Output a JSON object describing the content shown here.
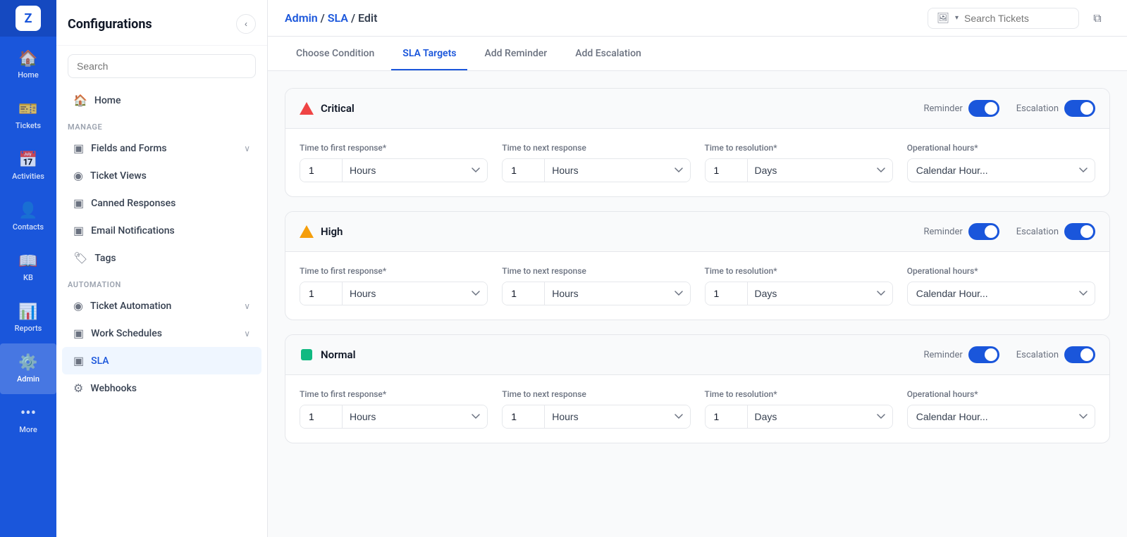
{
  "app": {
    "logo_letter": "Z"
  },
  "nav": {
    "items": [
      {
        "id": "home",
        "label": "Home",
        "icon": "🏠",
        "active": false
      },
      {
        "id": "tickets",
        "label": "Tickets",
        "icon": "🎫",
        "active": false
      },
      {
        "id": "activities",
        "label": "Activities",
        "icon": "📅",
        "active": false
      },
      {
        "id": "contacts",
        "label": "Contacts",
        "icon": "👤",
        "active": false
      },
      {
        "id": "kb",
        "label": "KB",
        "icon": "📖",
        "active": false
      },
      {
        "id": "reports",
        "label": "Reports",
        "icon": "📊",
        "active": false
      },
      {
        "id": "admin",
        "label": "Admin",
        "icon": "⚙️",
        "active": true
      },
      {
        "id": "more",
        "label": "More",
        "icon": "•••",
        "active": false
      }
    ]
  },
  "sidebar": {
    "title": "Configurations",
    "search_placeholder": "Search",
    "nav_items": [
      {
        "id": "home",
        "label": "Home",
        "icon": "🏠",
        "active": false,
        "has_chevron": false
      },
      {
        "id": "fields-forms",
        "label": "Fields and Forms",
        "icon": "▣",
        "active": false,
        "has_chevron": true
      },
      {
        "id": "ticket-views",
        "label": "Ticket Views",
        "icon": "◉",
        "active": false,
        "has_chevron": false
      },
      {
        "id": "canned-responses",
        "label": "Canned Responses",
        "icon": "▣",
        "active": false,
        "has_chevron": false
      },
      {
        "id": "email-notifications",
        "label": "Email Notifications",
        "icon": "▣",
        "active": false,
        "has_chevron": false
      },
      {
        "id": "tags",
        "label": "Tags",
        "icon": "🏷",
        "active": false,
        "has_chevron": false
      },
      {
        "id": "ticket-automation",
        "label": "Ticket Automation",
        "icon": "◉",
        "active": false,
        "has_chevron": true
      },
      {
        "id": "work-schedules",
        "label": "Work Schedules",
        "icon": "▣",
        "active": false,
        "has_chevron": true
      },
      {
        "id": "sla",
        "label": "SLA",
        "icon": "▣",
        "active": true,
        "has_chevron": false
      },
      {
        "id": "webhooks",
        "label": "Webhooks",
        "icon": "⚙",
        "active": false,
        "has_chevron": false
      }
    ],
    "sections": {
      "manage_label": "MANAGE",
      "automation_label": "AUTOMATION"
    }
  },
  "topbar": {
    "breadcrumb": "Admin/ SLA/ Edit",
    "breadcrumb_parts": [
      "Admin",
      "SLA",
      "Edit"
    ],
    "search_placeholder": "Search Tickets"
  },
  "tabs": [
    {
      "id": "choose-condition",
      "label": "Choose Condition",
      "active": false
    },
    {
      "id": "sla-targets",
      "label": "SLA Targets",
      "active": true
    },
    {
      "id": "add-reminder",
      "label": "Add Reminder",
      "active": false
    },
    {
      "id": "add-escalation",
      "label": "Add Escalation",
      "active": false
    }
  ],
  "sla_priorities": [
    {
      "id": "critical",
      "label": "Critical",
      "color": "red",
      "reminder_on": true,
      "escalation_on": true,
      "fields": {
        "first_response_value": "1",
        "first_response_unit": "Hours",
        "next_response_value": "1",
        "next_response_unit": "Hours",
        "resolution_value": "1",
        "resolution_unit": "Days",
        "operational_hours": "Calendar Hour..."
      }
    },
    {
      "id": "high",
      "label": "High",
      "color": "orange",
      "reminder_on": true,
      "escalation_on": true,
      "fields": {
        "first_response_value": "1",
        "first_response_unit": "Hours",
        "next_response_value": "1",
        "next_response_unit": "Hours",
        "resolution_value": "1",
        "resolution_unit": "Days",
        "operational_hours": "Calendar Hour..."
      }
    },
    {
      "id": "normal",
      "label": "Normal",
      "color": "green",
      "reminder_on": true,
      "escalation_on": true,
      "fields": {
        "first_response_value": "1",
        "first_response_unit": "Hours",
        "next_response_value": "1",
        "next_response_unit": "Hours",
        "resolution_value": "1",
        "resolution_unit": "Days",
        "operational_hours": "Calendar Hour..."
      }
    }
  ],
  "labels": {
    "reminder": "Reminder",
    "escalation": "Escalation",
    "time_first_response": "Time to first response*",
    "time_next_response": "Time to next response",
    "time_resolution": "Time to resolution*",
    "operational_hours": "Operational hours*",
    "hours_option": "Hours",
    "days_option": "Days",
    "calendar_hours": "Calendar Hour..."
  }
}
